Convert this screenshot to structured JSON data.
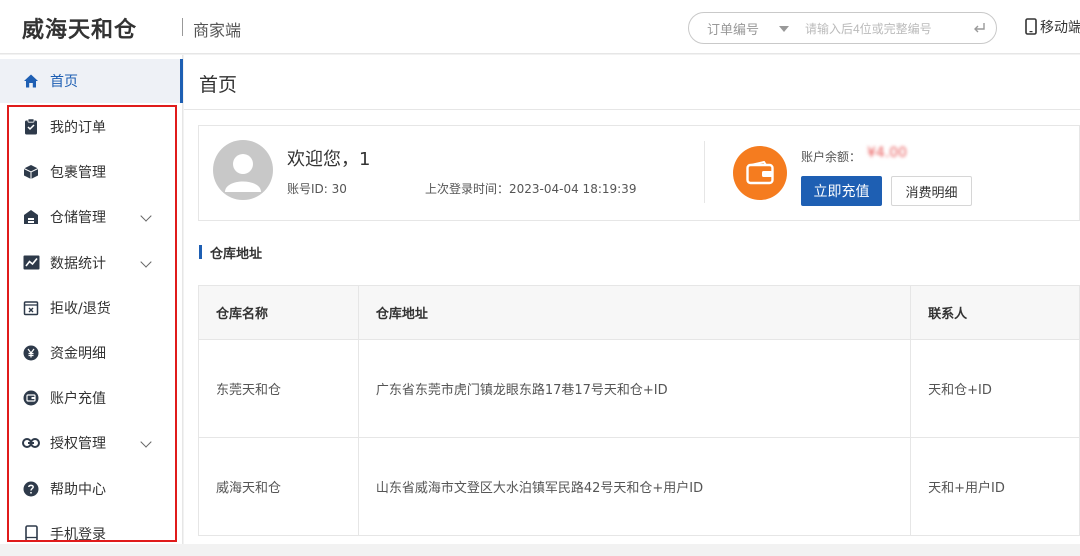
{
  "header": {
    "brand": "威海天和仓",
    "portal": "商家端",
    "search_type": "订单编号",
    "search_placeholder": "请输入后4位或完整编号",
    "mobile_label": "移动端"
  },
  "sidebar": {
    "items": [
      {
        "label": "首页",
        "icon": "home-icon",
        "active": true
      },
      {
        "label": "我的订单",
        "icon": "clipboard-icon"
      },
      {
        "label": "包裹管理",
        "icon": "package-icon"
      },
      {
        "label": "仓储管理",
        "icon": "warehouse-icon",
        "expandable": true
      },
      {
        "label": "数据统计",
        "icon": "chart-icon",
        "expandable": true
      },
      {
        "label": "拒收/退货",
        "icon": "return-box-icon"
      },
      {
        "label": "资金明细",
        "icon": "yuan-icon"
      },
      {
        "label": "账户充值",
        "icon": "wallet-icon"
      },
      {
        "label": "授权管理",
        "icon": "link-icon",
        "expandable": true
      },
      {
        "label": "帮助中心",
        "icon": "help-icon"
      },
      {
        "label": "手机登录",
        "icon": "phone-icon"
      }
    ]
  },
  "main": {
    "title": "首页",
    "welcome": {
      "greeting": "欢迎您，1",
      "account_id_label": "账号ID: 30",
      "last_login": "上次登录时间：2023-04-04 18:19:39",
      "balance_label": "账户余额：",
      "balance_value": "¥4.00",
      "recharge_button": "立即充值",
      "detail_button": "消费明细"
    },
    "section_title": "仓库地址",
    "table": {
      "headers": [
        "仓库名称",
        "仓库地址",
        "联系人"
      ],
      "rows": [
        [
          "东莞天和仓",
          "广东省东莞市虎门镇龙眼东路17巷17号天和仓+ID",
          "天和仓+ID"
        ],
        [
          "威海天和仓",
          "山东省威海市文登区大水泊镇军民路42号天和仓+用户ID",
          "天和+用户ID"
        ]
      ]
    }
  },
  "colors": {
    "accent": "#1e5fb3",
    "wallet": "#f57c1f",
    "highlight_box": "#e01b1b"
  }
}
